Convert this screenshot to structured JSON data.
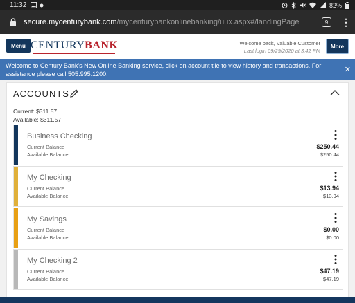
{
  "status": {
    "time": "11:32",
    "battery": "82%"
  },
  "browser": {
    "url_domain": "secure.mycenturybank.com",
    "url_path": "/mycenturybankonlinebanking/uux.aspx#/landingPage",
    "tab_count": "9"
  },
  "header": {
    "menu_label": "Menu",
    "logo_part1": "CENTURY",
    "logo_part2": "BANK",
    "welcome": "Welcome back, Valuable Customer",
    "last_login": "Last login 09/29/2020 at 3:42 PM",
    "more_label": "More"
  },
  "banner": {
    "text": "Welcome to Century Bank's New Online Banking service, click on account tile to view history and transactions. For assistance please call 505.995.1200.",
    "close": "✕"
  },
  "accounts": {
    "title": "ACCOUNTS",
    "current_summary": "Current: $311.57",
    "available_summary": "Available: $311.57",
    "current_label": "Current Balance",
    "available_label": "Available Balance",
    "items": [
      {
        "name": "Business Checking",
        "current": "$250.44",
        "available": "$250.44",
        "color": "#13365c"
      },
      {
        "name": "My Checking",
        "current": "$13.94",
        "available": "$13.94",
        "color": "#e0b03a"
      },
      {
        "name": "My Savings",
        "current": "$0.00",
        "available": "$0.00",
        "color": "#e8a014"
      },
      {
        "name": "My Checking 2",
        "current": "$47.19",
        "available": "$47.19",
        "color": "#b8b8b8"
      }
    ]
  }
}
